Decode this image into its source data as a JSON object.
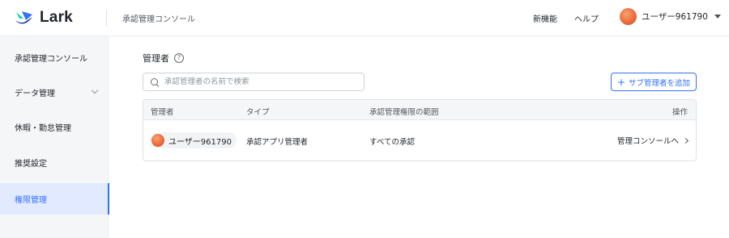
{
  "header": {
    "brand": "Lark",
    "console_title": "承認管理コンソール",
    "new_features": "新機能",
    "help": "ヘルプ",
    "user_name": "ユーザー961790"
  },
  "sidebar": {
    "items": [
      {
        "label": "承認管理コンソール",
        "active": false
      },
      {
        "label": "データ管理",
        "active": false,
        "has_submenu": true
      },
      {
        "label": "休暇・勤怠管理",
        "active": false
      },
      {
        "label": "推奨設定",
        "active": false
      },
      {
        "label": "権限管理",
        "active": true
      }
    ]
  },
  "main": {
    "title": "管理者",
    "search": {
      "placeholder": "承認管理者の名前で検索",
      "value": ""
    },
    "add_button": "サブ管理者を追加",
    "table": {
      "headers": [
        "管理者",
        "タイプ",
        "承認管理権限の範囲",
        "操作"
      ],
      "rows": [
        {
          "admin": "ユーザー961790",
          "type": "承認アプリ管理者",
          "scope": "すべての承認",
          "action": "管理コンソールへ"
        }
      ]
    }
  },
  "colors": {
    "accent": "#3370ff",
    "sidebar_bg": "#f5f6f7",
    "active_bg": "#e1eaff",
    "logo_blue": "#3370ff",
    "logo_teal": "#00d6b9",
    "logo_navy": "#133c9a"
  }
}
